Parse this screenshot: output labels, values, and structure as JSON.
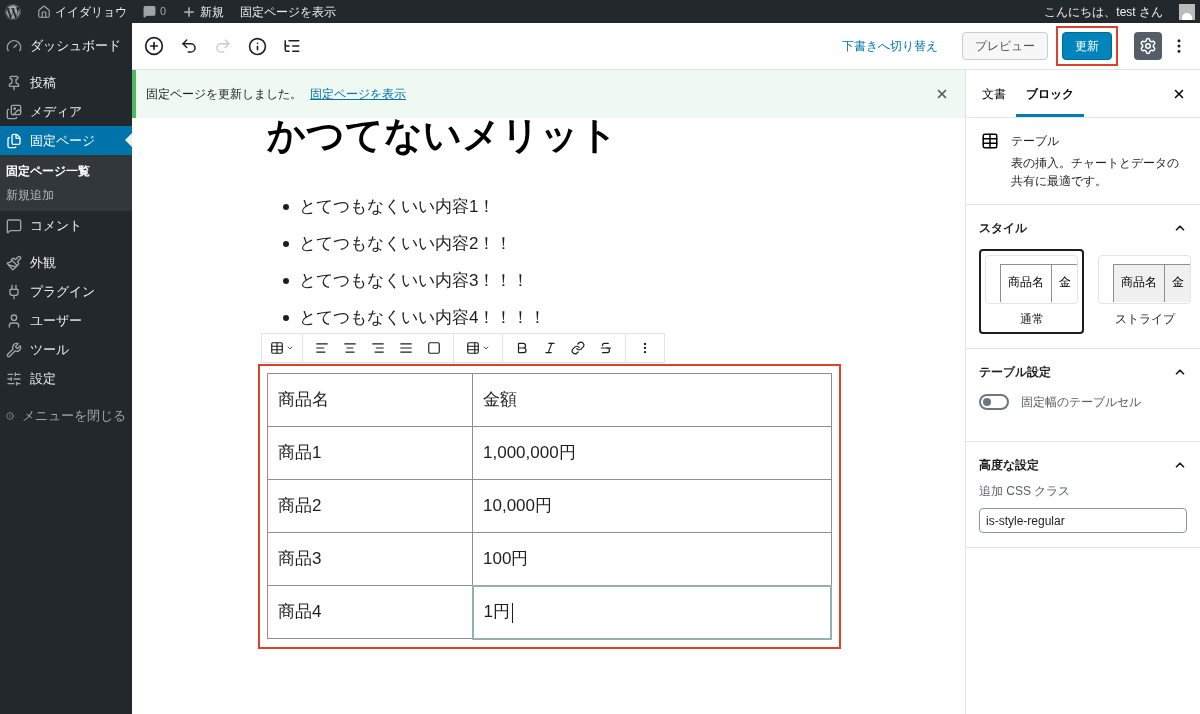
{
  "admin_bar": {
    "site_name": "イイダリョウ",
    "comments": "0",
    "new": "新規",
    "view": "固定ページを表示",
    "greeting": "こんにちは、test さん"
  },
  "sidebar": {
    "groups": [
      [
        {
          "kind": "menu",
          "label": "ダッシュボード",
          "selected": false
        }
      ],
      [
        {
          "kind": "menu",
          "label": "投稿",
          "selected": false
        },
        {
          "kind": "menu",
          "label": "メディア",
          "selected": false
        },
        {
          "kind": "menu",
          "label": "固定ページ",
          "selected": true,
          "children": [
            {
              "label": "固定ページ一覧",
              "selected": true
            },
            {
              "label": "新規追加",
              "selected": false
            }
          ]
        },
        {
          "kind": "menu",
          "label": "コメント",
          "selected": false
        }
      ],
      [
        {
          "kind": "menu",
          "label": "外観",
          "selected": false
        },
        {
          "kind": "menu",
          "label": "プラグイン",
          "selected": false
        },
        {
          "kind": "menu",
          "label": "ユーザー",
          "selected": false
        },
        {
          "kind": "menu",
          "label": "ツール",
          "selected": false
        },
        {
          "kind": "menu",
          "label": "設定",
          "selected": false
        }
      ],
      [
        {
          "kind": "collapse",
          "label": "メニューを閉じる",
          "selected": false
        }
      ]
    ]
  },
  "header": {
    "switch_draft": "下書きへ切り替え",
    "preview": "プレビュー",
    "update": "更新",
    "settings_on": true
  },
  "notice": {
    "message": "固定ページを更新しました。",
    "link": "固定ページを表示"
  },
  "editor": {
    "heading": "かつてないメリット",
    "list": [
      "とてつもなくいい内容1！",
      "とてつもなくいい内容2！！",
      "とてつもなくいい内容3！！！",
      "とてつもなくいい内容4！！！！"
    ],
    "table": {
      "rows": [
        [
          {
            "text": "商品名",
            "selected": false
          },
          {
            "text": "金額",
            "selected": false
          }
        ],
        [
          {
            "text": "商品1",
            "selected": false
          },
          {
            "text": "1,000,000円",
            "selected": false
          }
        ],
        [
          {
            "text": "商品2",
            "selected": false
          },
          {
            "text": "10,000円",
            "selected": false
          }
        ],
        [
          {
            "text": "商品3",
            "selected": false
          },
          {
            "text": "100円",
            "selected": false
          }
        ],
        [
          {
            "text": "商品4",
            "selected": false
          },
          {
            "text": "1円",
            "selected": true
          }
        ]
      ]
    }
  },
  "panel": {
    "tabs": [
      {
        "label": "文書",
        "selected": false
      },
      {
        "label": "ブロック",
        "selected": true
      }
    ],
    "block": {
      "name": "テーブル",
      "description": "表の挿入。チャートとデータの共有に最適です。"
    },
    "styles": {
      "title": "スタイル",
      "expanded": true,
      "options": [
        {
          "label": "通常",
          "selected": true,
          "striped": false,
          "cells": [
            "商品名",
            "金"
          ]
        },
        {
          "label": "ストライプ",
          "selected": false,
          "striped": true,
          "cells": [
            "商品名",
            "金"
          ]
        }
      ]
    },
    "table_settings": {
      "title": "テーブル設定",
      "expanded": true,
      "toggle": {
        "label": "固定幅のテーブルセル",
        "on": false
      }
    },
    "advanced": {
      "title": "高度な設定",
      "expanded": true,
      "field": {
        "label": "追加 CSS クラス",
        "value": "is-style-regular"
      }
    }
  }
}
